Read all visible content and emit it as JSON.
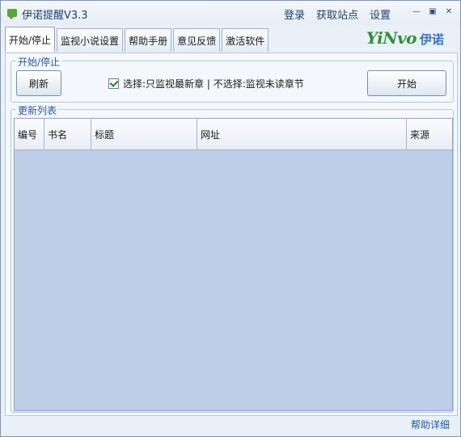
{
  "window": {
    "title": "伊诺提醒V3.3"
  },
  "topbar": {
    "login": "登录",
    "get_sites": "获取站点",
    "settings": "设置"
  },
  "window_buttons": {
    "minimize": "—",
    "restore": "▣",
    "close": "✕"
  },
  "tabs": [
    {
      "label": "开始/停止"
    },
    {
      "label": "监视小说设置"
    },
    {
      "label": "帮助手册"
    },
    {
      "label": "意见反馈"
    },
    {
      "label": "激活软件"
    }
  ],
  "brand": {
    "latin": "YiNvo",
    "cn": "伊诺"
  },
  "start_group": {
    "title": "开始/停止",
    "refresh_button": "刷新",
    "option_text": "选择:只监视最新章 | 不选择:监视未读章节",
    "option_checked": true,
    "start_button": "开始"
  },
  "list_group": {
    "title": "更新列表",
    "columns": [
      "编号",
      "书名",
      "标题",
      "网址",
      "来源"
    ],
    "rows": []
  },
  "footer": {
    "help_detail": "帮助详细"
  },
  "colors": {
    "accent": "#2f8f3a",
    "brand_blue": "#3b74c8",
    "list_bg": "#bccfe6"
  }
}
